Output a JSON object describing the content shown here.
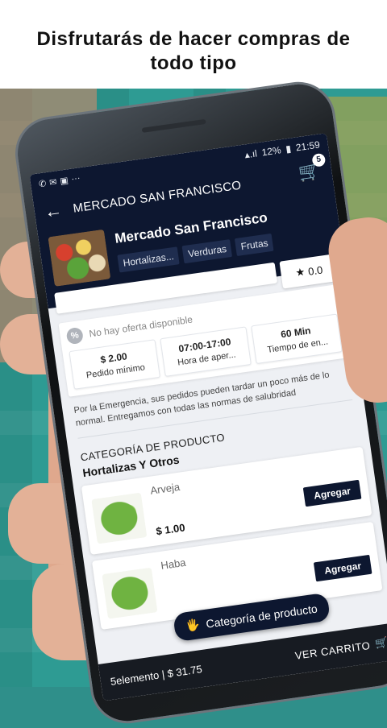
{
  "promo": {
    "line1": "Disfrutarás de hacer compras de",
    "line2": "todo tipo"
  },
  "status": {
    "battery": "12%",
    "time": "21:59",
    "notif_icons": [
      "phone-icon",
      "mail-icon",
      "gallery-icon"
    ]
  },
  "appbar": {
    "title": "MERCADO SAN FRANCISCO",
    "cart_count": "5"
  },
  "store": {
    "name": "Mercado San Francisco",
    "tags": [
      "Hortalizas...",
      "Verduras",
      "Frutas"
    ],
    "rating": "0.0",
    "offer": "No hay oferta disponible",
    "stats": [
      {
        "value": "$ 2.00",
        "label": "Pedido mínimo"
      },
      {
        "value": "07:00-17:00",
        "label": "Hora de aper..."
      },
      {
        "value": "60 Min",
        "label": "Tiempo de en..."
      }
    ],
    "notice": "Por la Emergencia, sus pedidos pueden tardar un poco más de lo normal. Entregamos con todas las normas de salubridad"
  },
  "catalog": {
    "title": "CATEGORÍA DE PRODUCTO",
    "subtitle": "Hortalizas Y Otros",
    "products": [
      {
        "name": "Arveja",
        "price": "$ 1.00",
        "button": "Agregar"
      },
      {
        "name": "Haba",
        "price": "",
        "button": "Agregar"
      }
    ]
  },
  "fab": {
    "label": "Categoría de producto"
  },
  "footer": {
    "summary": "5elemento | $ 31.75",
    "cart_label": "VER CARRITO"
  }
}
